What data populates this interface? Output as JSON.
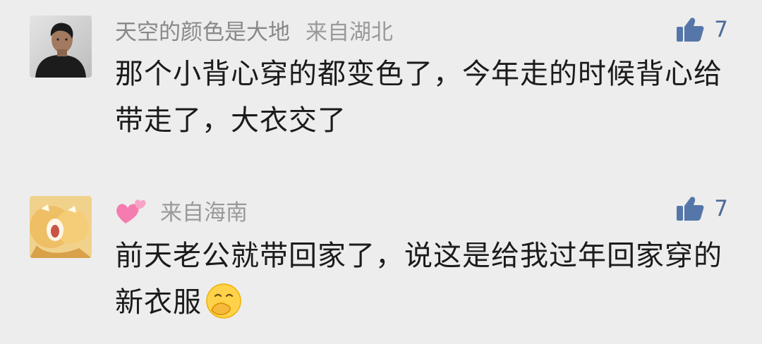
{
  "comments": [
    {
      "nickname": "天空的颜色是大地",
      "location": "来自湖北",
      "likes": "7",
      "text": "那个小背心穿的都变色了，今年走的时候背心给带走了，大衣交了",
      "avatar_icon": "person-photo-avatar"
    },
    {
      "nickname": "",
      "location": "来自海南",
      "likes": "7",
      "text": "前天老公就带回家了，说这是给我过年回家穿的新衣服",
      "avatar_icon": "cartoon-avatar",
      "nickname_icon": "pink-hearts-icon",
      "emoji_icon": "hand-over-mouth-emoji"
    }
  ],
  "colors": {
    "background": "#ededed",
    "like_blue": "#4b6b98",
    "meta_gray": "#8f8f8f",
    "text": "#1b1b1b",
    "heart_pink": "#f47cae"
  }
}
